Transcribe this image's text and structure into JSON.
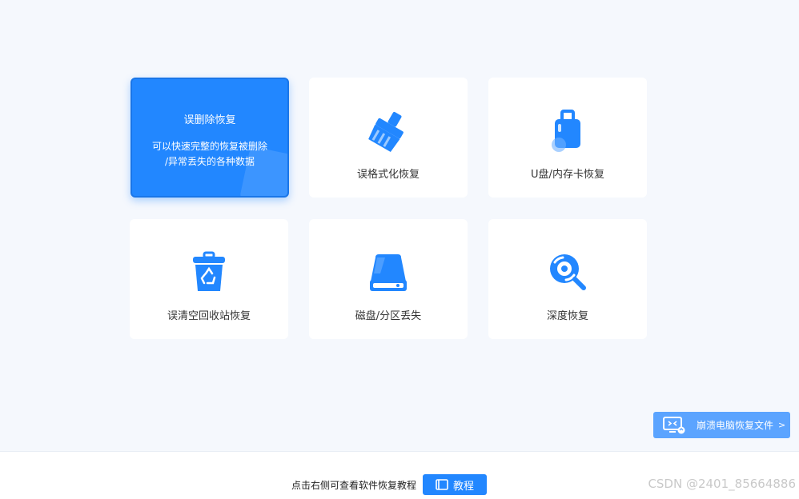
{
  "cards": [
    {
      "title": "误删除恢复",
      "desc_line1": "可以快速完整的恢复被删除",
      "desc_line2": "/异常丢失的各种数据",
      "icon": "trash-restore-icon",
      "active": true
    },
    {
      "label": "误格式化恢复",
      "icon": "broom-icon"
    },
    {
      "label": "U盘/内存卡恢复",
      "icon": "usb-drive-icon"
    },
    {
      "label": "误清空回收站恢复",
      "icon": "recycle-bin-icon"
    },
    {
      "label": "磁盘/分区丢失",
      "icon": "hard-disk-icon"
    },
    {
      "label": "深度恢复",
      "icon": "deep-scan-icon"
    }
  ],
  "crash_button": {
    "label": "崩溃电脑恢复文件",
    "arrow": ">",
    "icon": "monitor-icon"
  },
  "footer": {
    "hint": "点击右侧可查看软件恢复教程",
    "tutorial_label": "教程",
    "icon": "book-icon"
  },
  "watermark": "CSDN @2401_85664886",
  "colors": {
    "accent": "#2287ff",
    "accent_light": "#5ba4ff",
    "background": "#f5f8fd"
  }
}
